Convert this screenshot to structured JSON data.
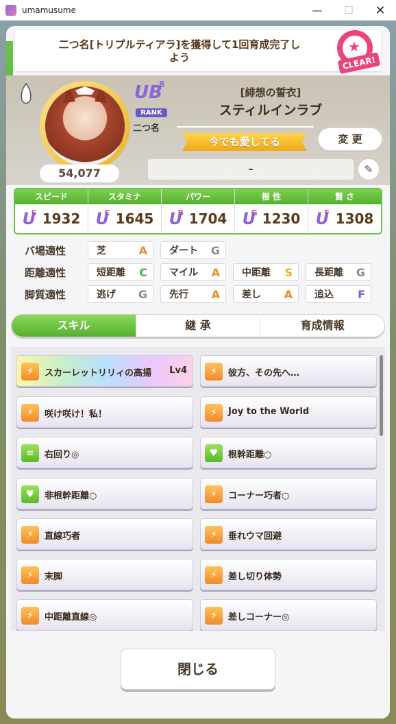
{
  "window": {
    "title": "umamusume",
    "minimize": "—",
    "maximize": "☐",
    "close": "✕"
  },
  "mission": {
    "text": "二つ名[トリプルティアラ]を獲得して1回育成完了しよう",
    "stamp": "CLEAR!",
    "stamp_star": "★"
  },
  "profile": {
    "score": "54,077",
    "rank": {
      "grade": "UB",
      "level": "8",
      "label": "RANK"
    },
    "nickname_tag": "二つ名",
    "epithet": "[緋想の誓衣]",
    "name": "スティルインラブ",
    "title": "今でも愛してる",
    "change_label": "変 更",
    "comment": "–",
    "edit_icon": "pencil-icon"
  },
  "stats": [
    {
      "label": "スピード",
      "grade": "U",
      "sub": "S",
      "rank": "3",
      "value": "1932"
    },
    {
      "label": "スタミナ",
      "grade": "U",
      "sub": "C",
      "rank": "4",
      "value": "1645"
    },
    {
      "label": "パワー",
      "grade": "U",
      "sub": "B",
      "rank": "",
      "value": "1704"
    },
    {
      "label": "根 性",
      "grade": "U",
      "sub": "G",
      "rank": "3",
      "value": "1230"
    },
    {
      "label": "賢 さ",
      "grade": "U",
      "sub": "F",
      "rank": "",
      "value": "1308"
    }
  ],
  "aptitude": {
    "track": {
      "label": "バ場適性",
      "items": [
        {
          "name": "芝",
          "grade": "A"
        },
        {
          "name": "ダート",
          "grade": "G"
        }
      ]
    },
    "distance": {
      "label": "距離適性",
      "items": [
        {
          "name": "短距離",
          "grade": "C"
        },
        {
          "name": "マイル",
          "grade": "A"
        },
        {
          "name": "中距離",
          "grade": "S"
        },
        {
          "name": "長距離",
          "grade": "G"
        }
      ]
    },
    "style": {
      "label": "脚質適性",
      "items": [
        {
          "name": "逃げ",
          "grade": "G"
        },
        {
          "name": "先行",
          "grade": "A"
        },
        {
          "name": "差し",
          "grade": "A"
        },
        {
          "name": "追込",
          "grade": "F"
        }
      ]
    }
  },
  "tabs": [
    {
      "label": "スキル"
    },
    {
      "label": "継 承"
    },
    {
      "label": "育成情報"
    }
  ],
  "skills": [
    {
      "name": "スカーレットリリィの高揚",
      "level": "Lv4"
    },
    {
      "name": "彼方、その先へ…"
    },
    {
      "name": "咲け咲け！私！"
    },
    {
      "name": "Joy to the World"
    },
    {
      "name": "右回り◎"
    },
    {
      "name": "根幹距離○"
    },
    {
      "name": "非根幹距離○"
    },
    {
      "name": "コーナー巧者○"
    },
    {
      "name": "直線巧者"
    },
    {
      "name": "垂れウマ回避"
    },
    {
      "name": "末脚"
    },
    {
      "name": "差し切り体勢"
    },
    {
      "name": "中距離直線◎"
    },
    {
      "name": "差しコーナー◎"
    }
  ],
  "close_label": "閉じる"
}
